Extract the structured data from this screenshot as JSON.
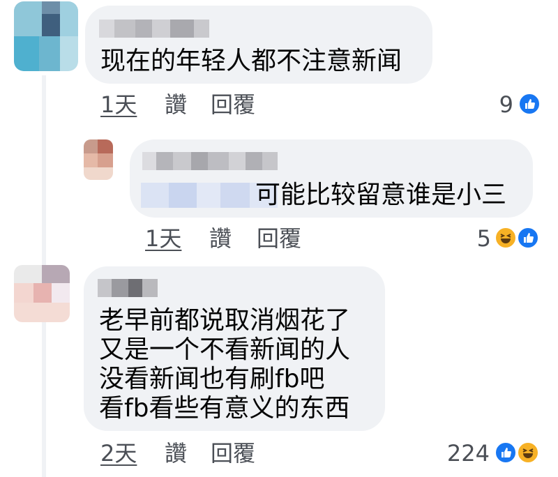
{
  "comments": [
    {
      "text_lines": [
        "现在的年轻人都不注意新闻"
      ],
      "time": "1天",
      "like_label": "讚",
      "reply_label": "回覆",
      "reaction_count": "9",
      "reactions": [
        "like-icon"
      ]
    },
    {
      "text_lines": [
        "可能比较留意谁是小三"
      ],
      "time": "1天",
      "like_label": "讚",
      "reply_label": "回覆",
      "reaction_count": "5",
      "reactions": [
        "haha-icon",
        "like-icon"
      ]
    },
    {
      "text_lines": [
        "老早前都说取消烟花了",
        "又是一个不看新闻的人",
        "没看新闻也有刷fb吧",
        "看fb看些有意义的东西"
      ],
      "time": "2天",
      "like_label": "讚",
      "reply_label": "回覆",
      "reaction_count": "224",
      "reactions": [
        "like-icon",
        "haha-icon"
      ]
    }
  ],
  "colors": {
    "bubble": "#f0f2f5",
    "like": "#1877f2",
    "haha": "#f7b125",
    "meta": "#4b4f56"
  }
}
